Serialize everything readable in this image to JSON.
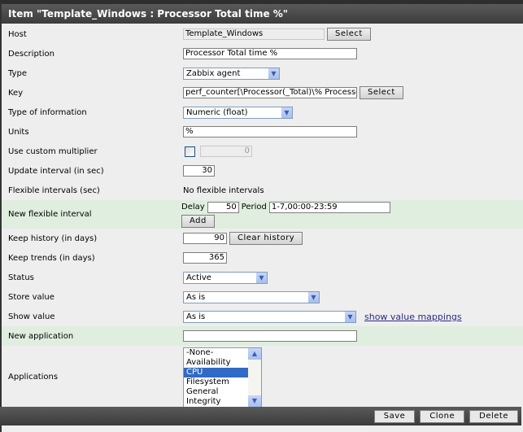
{
  "title": "Item \"Template_Windows : Processor Total time %\"",
  "labels": {
    "host": "Host",
    "description": "Description",
    "type": "Type",
    "key": "Key",
    "type_info": "Type of information",
    "units": "Units",
    "multiplier": "Use custom multiplier",
    "update": "Update interval (in sec)",
    "flex": "Flexible intervals (sec)",
    "new_flex": "New flexible interval",
    "history": "Keep history (in days)",
    "trends": "Keep trends (in days)",
    "status": "Status",
    "store": "Store value",
    "show": "Show value",
    "new_app": "New application",
    "apps": "Applications"
  },
  "values": {
    "host": "Template_Windows",
    "description": "Processor Total time %",
    "type": "Zabbix agent",
    "key": "perf_counter[\\Processor(_Total)\\% Processor Time]",
    "type_info": "Numeric (float)",
    "units": "%",
    "multiplier": "0",
    "update": "30",
    "flex": "No flexible intervals",
    "delay_label": "Delay",
    "delay": "50",
    "period_label": "Period",
    "period": "1-7,00:00-23:59",
    "history": "90",
    "trends": "365",
    "status": "Active",
    "store": "As is",
    "show": "As is",
    "new_app": ""
  },
  "buttons": {
    "select": "Select",
    "add": "Add",
    "clear_history": "Clear history",
    "save": "Save",
    "clone": "Clone",
    "delete": "Delete"
  },
  "show_mappings": "show value mappings",
  "applications": [
    "-None-",
    "Availability",
    "CPU",
    "Filesystem",
    "General",
    "Integrity"
  ],
  "selected_application": "CPU"
}
